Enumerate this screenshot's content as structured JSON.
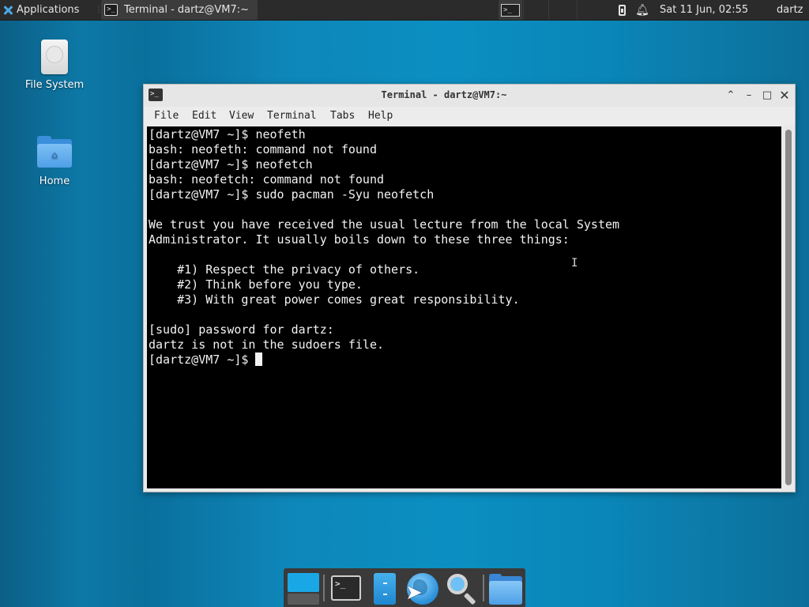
{
  "top_panel": {
    "applications_label": "Applications",
    "task_title": "Terminal - dartz@VM7:~",
    "clock": "Sat 11 Jun, 02:55",
    "user": "dartz"
  },
  "desktop": {
    "icons": [
      {
        "label": "File System",
        "icon": "drive-icon"
      },
      {
        "label": "Home",
        "icon": "home-folder-icon"
      }
    ]
  },
  "window": {
    "title": "Terminal - dartz@VM7:~",
    "menu": {
      "file": "File",
      "edit": "Edit",
      "view": "View",
      "terminal": "Terminal",
      "tabs": "Tabs",
      "help": "Help"
    }
  },
  "terminal": {
    "lines": [
      "[dartz@VM7 ~]$ neofeth",
      "bash: neofeth: command not found",
      "[dartz@VM7 ~]$ neofetch",
      "bash: neofetch: command not found",
      "[dartz@VM7 ~]$ sudo pacman -Syu neofetch",
      "",
      "We trust you have received the usual lecture from the local System",
      "Administrator. It usually boils down to these three things:",
      "",
      "    #1) Respect the privacy of others.",
      "    #2) Think before you type.",
      "    #3) With great power comes great responsibility.",
      "",
      "[sudo] password for dartz:",
      "dartz is not in the sudoers file.",
      "[dartz@VM7 ~]$ "
    ]
  },
  "colors": {
    "desktop_bg": "#0b86b8",
    "panel_bg": "#2b2b2b",
    "terminal_bg": "#000000",
    "terminal_fg": "#f2f2f2"
  }
}
